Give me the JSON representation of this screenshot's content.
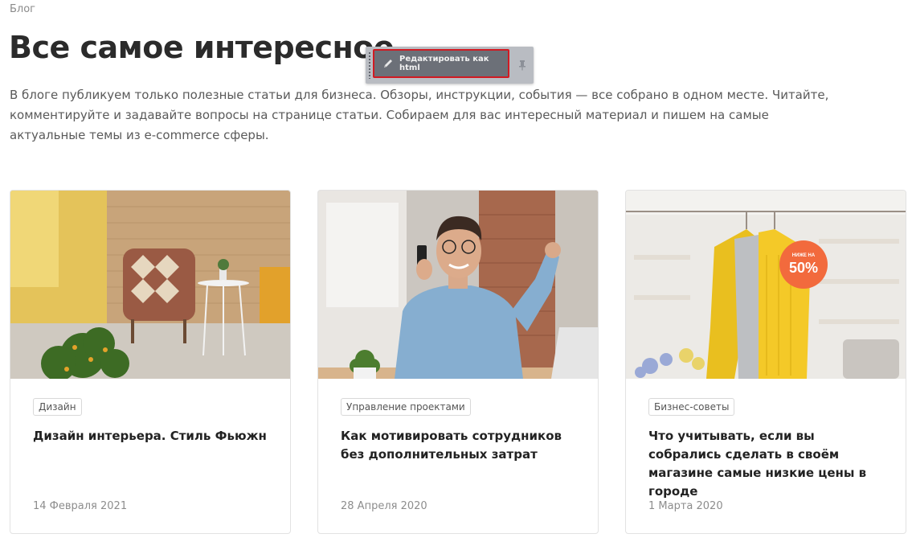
{
  "breadcrumb": "Блог",
  "title": "Все самое интересное",
  "toolbar": {
    "edit_label": "Редактировать как html"
  },
  "lead": "В блоге публикуем только полезные статьи для бизнеса. Обзоры, инструкции, события — все собрано в одном месте. Читайте, комментируйте и задавайте вопросы на странице статьи. Собираем для вас интересный материал и пишем на самые актуальные темы из e-commerce сферы.",
  "cards": [
    {
      "tag": "Дизайн",
      "title": "Дизайн интерьера. Стиль Фьюжн",
      "date": "14 Февраля 2021"
    },
    {
      "tag": "Управление проектами",
      "title": "Как мотивировать сотрудников без дополнительных затрат",
      "date": "28 Апреля 2020"
    },
    {
      "tag": "Бизнес-советы",
      "title": "Что учитывать, если вы собрались сделать в своём магазине самые низкие цены в городе",
      "date": "1 Марта 2020",
      "badge_small": "НИЖЕ НА",
      "badge_big": "50%"
    }
  ],
  "colors": {
    "accent_badge": "#f26a3d",
    "toolbar_highlight": "#d11a22"
  }
}
